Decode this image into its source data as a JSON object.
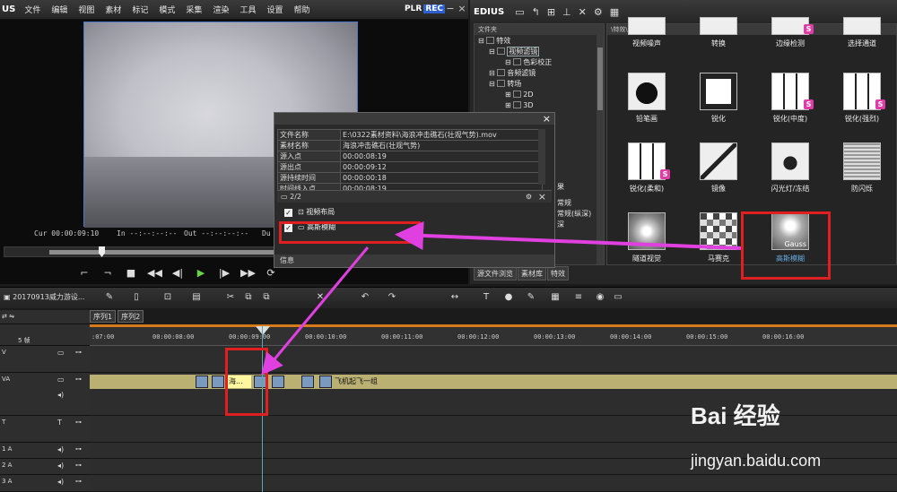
{
  "app": {
    "logo": "US",
    "name": "EDIUS"
  },
  "menu": [
    "文件",
    "编辑",
    "视图",
    "素材",
    "标记",
    "模式",
    "采集",
    "渲染",
    "工具",
    "设置",
    "帮助"
  ],
  "player": {
    "plr": "PLR",
    "rec": "REC",
    "cur": "Cur 00:00:09:10",
    "in": "In --:--:--:--",
    "out": "Out --:--:--:--",
    "dur": "Du"
  },
  "tree": {
    "header": "文件夹",
    "nodes": [
      "特效",
      "视频滤镜",
      "色彩校正",
      "音频滤镜",
      "转场",
      "2D",
      "3D"
    ]
  },
  "grid": {
    "header": "\\特效\\视频滤镜\\",
    "effects": [
      {
        "label": "视频噪声"
      },
      {
        "label": "转换"
      },
      {
        "label": "边缘检测"
      },
      {
        "label": "选择通道"
      },
      {
        "label": "铅笔画"
      },
      {
        "label": "锐化"
      },
      {
        "label": "锐化(中度)"
      },
      {
        "label": "锐化(强烈)"
      },
      {
        "label": "锐化(柔和)"
      },
      {
        "label": "镜像"
      },
      {
        "label": "闪光灯/冻结"
      },
      {
        "label": "防闪烁"
      },
      {
        "label": "隧道视觉"
      },
      {
        "label": "马赛克"
      },
      {
        "label": "高斯模糊",
        "overlay": "Gauss"
      }
    ],
    "s_badge": "S"
  },
  "right_tabs": [
    "源文件浏览",
    "素材库",
    "特效"
  ],
  "tree_extra": [
    "果",
    "常规",
    "常规(纵深)",
    "深"
  ],
  "dialog": {
    "rows": [
      {
        "k": "文件名称",
        "v": "E:\\0322素材资料\\海浪冲击礁石(壮观气势).mov"
      },
      {
        "k": "素材名称",
        "v": "海浪冲击礁石(壮观气势)"
      },
      {
        "k": "源入点",
        "v": "00:00:08:19"
      },
      {
        "k": "源出点",
        "v": "00:00:09:12"
      },
      {
        "k": "源持续时间",
        "v": "00:00:00:18"
      },
      {
        "k": "时间线入点",
        "v": "00:00:08:19"
      }
    ],
    "page": "2/2",
    "filters": [
      {
        "label": "视频布局",
        "checked": "✓"
      },
      {
        "label": "高斯模糊",
        "checked": "✓"
      }
    ],
    "footer": "信息"
  },
  "timeline": {
    "project": "20170913威力游设...",
    "seq_tabs": [
      "序列1",
      "序列2"
    ],
    "zoom": "5 帧",
    "ruler": [
      ":07:00",
      "00:00:08:00",
      "00:00:09:00",
      "00:00:10:00",
      "00:00:11:00",
      "00:00:12:00",
      "00:00:13:00",
      "00:00:14:00",
      "00:00:15:00",
      "00:00:16:00"
    ],
    "tracks": [
      "V",
      "VA",
      "T",
      "1 A",
      "2 A",
      "3 A"
    ],
    "clip_short": "海...",
    "clip_label": "飞机起飞一组"
  },
  "watermark": {
    "text": "Bai 经验",
    "url": "jingyan.baidu.com"
  },
  "colors": {
    "highlight": "#e02020",
    "arrow": "#e040e0",
    "accent": "#2d5fd0"
  }
}
